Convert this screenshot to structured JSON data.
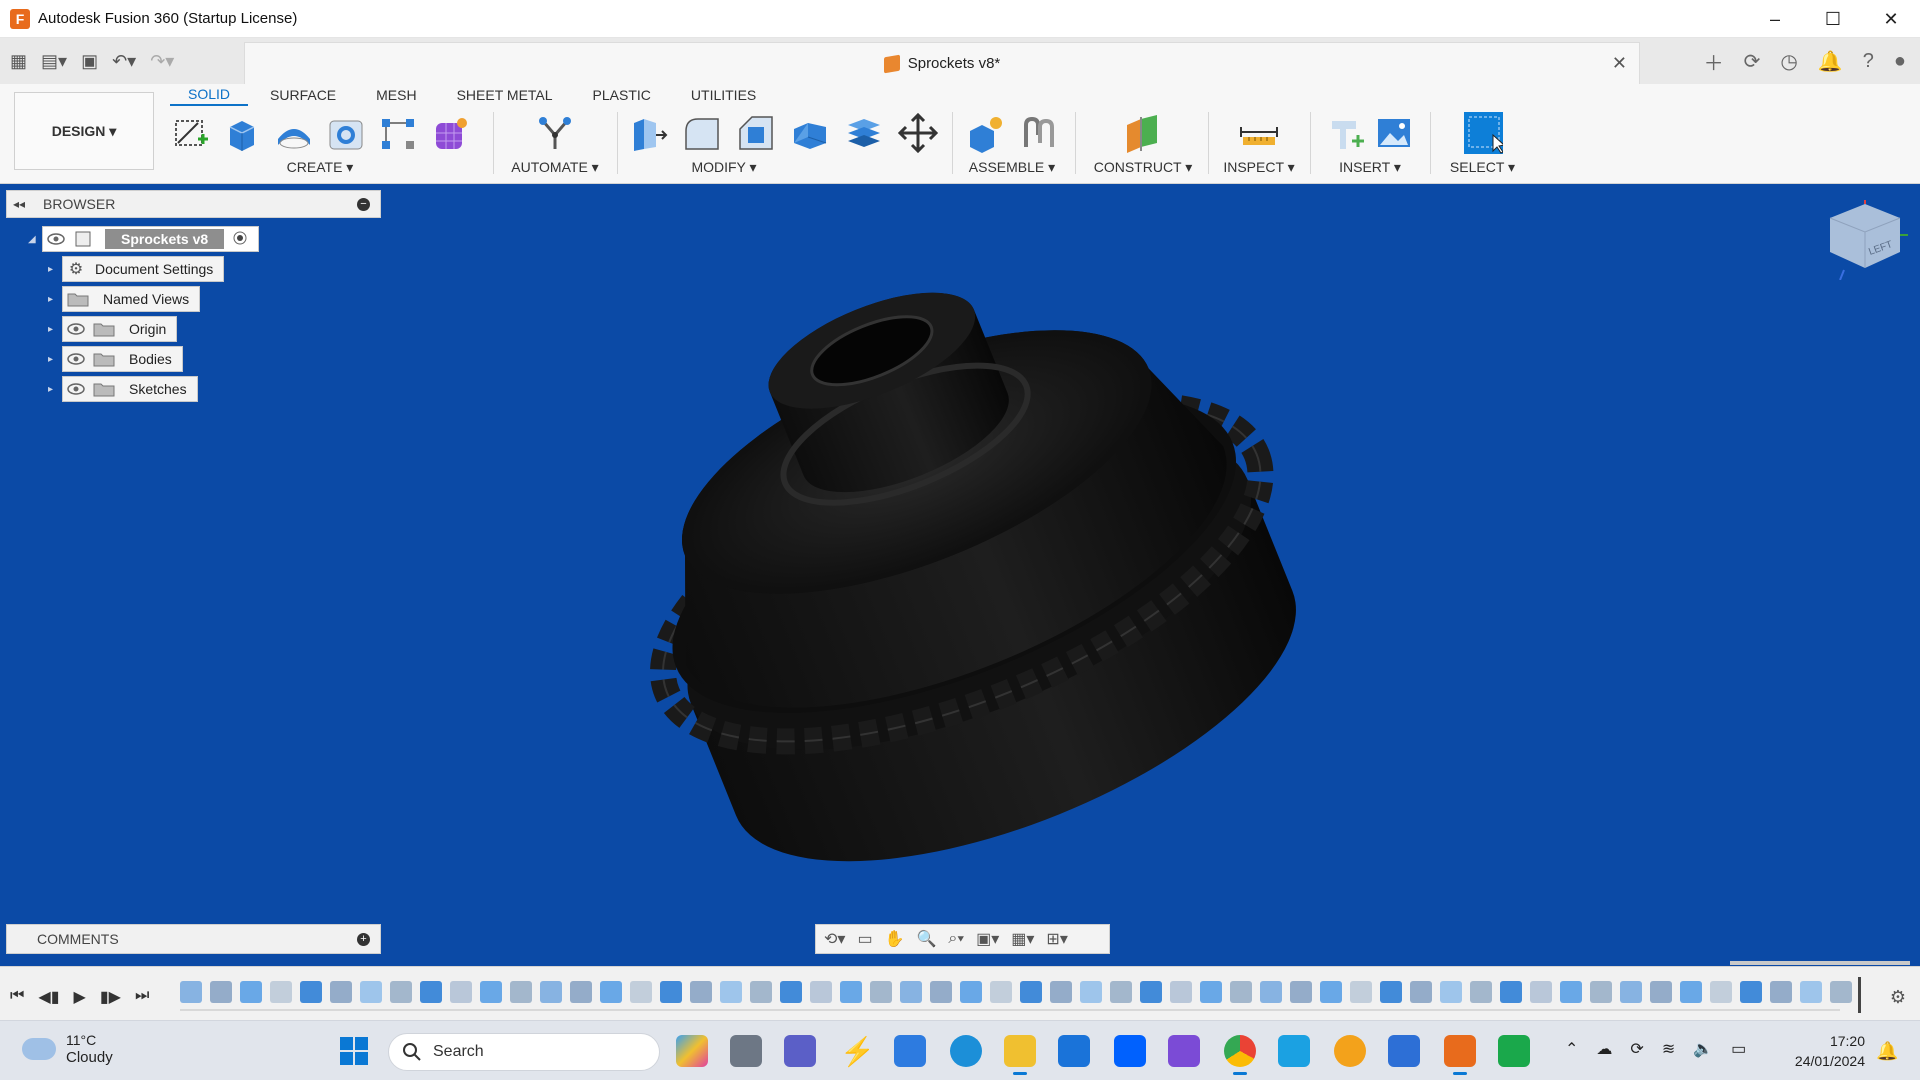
{
  "window": {
    "title": "Autodesk Fusion 360 (Startup License)",
    "controls": [
      "–",
      "☐",
      "✕"
    ]
  },
  "document_tab": {
    "name": "Sprockets v8*"
  },
  "workspace": {
    "label": "DESIGN ▾"
  },
  "tabs": [
    "SOLID",
    "SURFACE",
    "MESH",
    "SHEET METAL",
    "PLASTIC",
    "UTILITIES"
  ],
  "groups": {
    "create": "CREATE ▾",
    "automate": "AUTOMATE ▾",
    "modify": "MODIFY ▾",
    "assemble": "ASSEMBLE ▾",
    "construct": "CONSTRUCT ▾",
    "inspect": "INSPECT ▾",
    "insert": "INSERT ▾",
    "select": "SELECT ▾"
  },
  "browser": {
    "title": "BROWSER",
    "root": "Sprockets v8",
    "items": [
      "Document Settings",
      "Named Views",
      "Origin",
      "Bodies",
      "Sketches"
    ]
  },
  "comments": {
    "title": "COMMENTS"
  },
  "viewcube": {
    "label": "LEFT"
  },
  "taskbar": {
    "weather_temp": "11°C",
    "weather_cond": "Cloudy",
    "search_placeholder": "Search",
    "time": "17:20",
    "date": "24/01/2024"
  },
  "colors": {
    "accent": "#0d72c8",
    "viewport": "#0b4aa6",
    "part": "#0c0c0c"
  }
}
